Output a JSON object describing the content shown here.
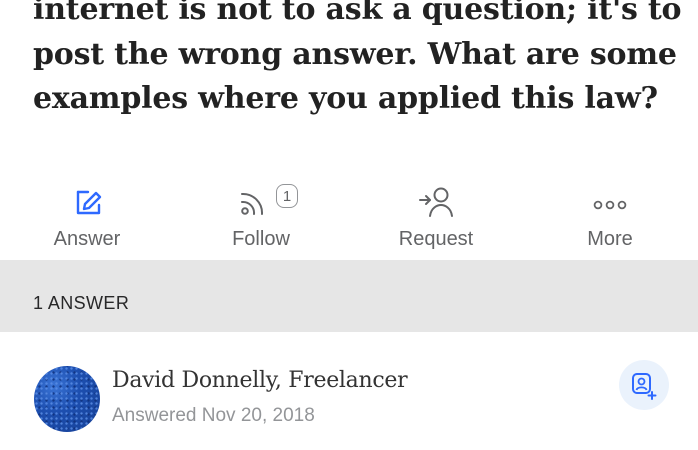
{
  "question": {
    "text": "internet is not to ask a question; it's to post the wrong answer. What are some examples where you applied this law?"
  },
  "actions": [
    {
      "label": "Answer",
      "icon": "pencil-icon"
    },
    {
      "label": "Follow",
      "icon": "rss-icon",
      "count": "1"
    },
    {
      "label": "Request",
      "icon": "request-user-icon"
    },
    {
      "label": "More",
      "icon": "more-dots-icon"
    }
  ],
  "answers": {
    "count_label": "1 ANSWER",
    "items": [
      {
        "author": "David Donnelly, Freelancer",
        "date": "Answered Nov 20, 2018",
        "avatar_color": "#1d4fb0"
      }
    ]
  },
  "colors": {
    "accent": "#2e69ff",
    "text": "#282829",
    "muted": "#636466",
    "header_bg": "#e6e6e6"
  }
}
